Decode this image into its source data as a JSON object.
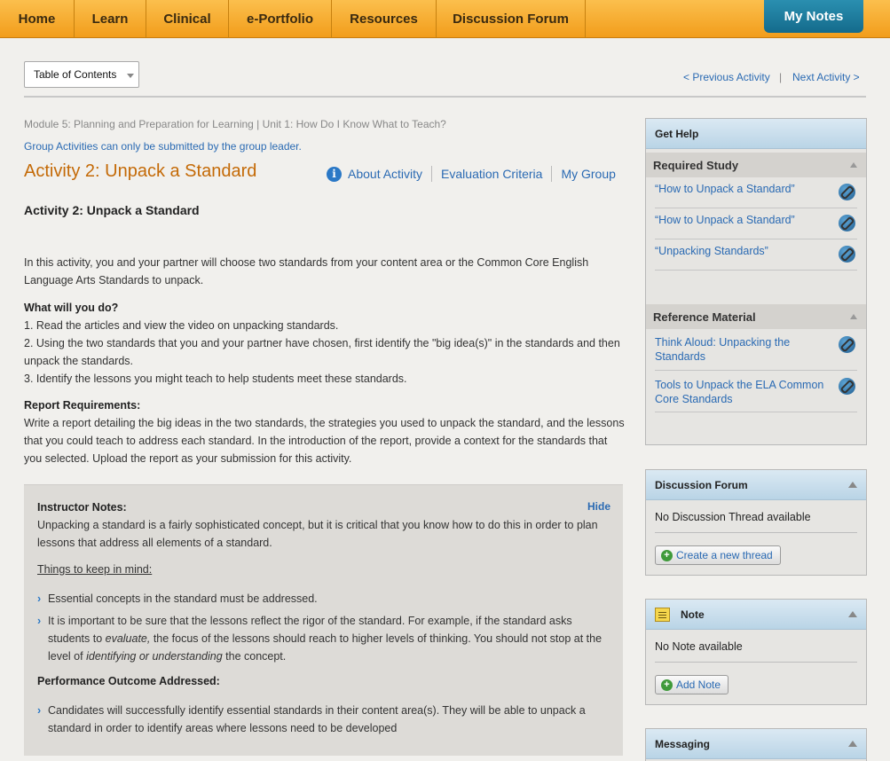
{
  "nav": {
    "items": [
      "Home",
      "Learn",
      "Clinical",
      "e-Portfolio",
      "Resources",
      "Discussion Forum"
    ],
    "my_notes": "My Notes"
  },
  "toolbar": {
    "toc_label": "Table of Contents",
    "previous_activity": "< Previous Activity",
    "separator": "|",
    "next_activity": "Next Activity >"
  },
  "main": {
    "breadcrumb": "Module 5: Planning and Preparation for Learning | Unit 1: How Do I Know What to Teach?",
    "group_note": "Group Activities can only be submitted by the group leader.",
    "title": "Activity 2: Unpack a Standard",
    "links": {
      "about": "About Activity",
      "evaluation": "Evaluation Criteria",
      "group": "My Group"
    },
    "subheading": "Activity 2: Unpack a Standard",
    "intro": "In this activity, you and your partner will choose two standards from your content area or the Common Core English Language Arts Standards to unpack.",
    "what_heading": "What will you do?",
    "steps": [
      "1. Read the articles and view the video on unpacking standards.",
      "2. Using the two standards that you and your partner have chosen, first identify the \"big idea(s)\" in the standards and then unpack the standards.",
      "3. Identify the lessons you might teach to help students meet these standards."
    ],
    "report_heading": "Report Requirements:",
    "report_text": "Write a report detailing the big ideas in the two standards, the strategies you used to unpack the standard, and the lessons that you could teach to address each standard. In the introduction of the report, provide a context for the standards that you selected. Upload the report as your submission for this activity."
  },
  "instructor_notes": {
    "heading": "Instructor Notes:",
    "hide": "Hide",
    "text": "Unpacking a standard is a fairly sophisticated concept, but it is critical that you know how to do this in order to plan lessons that address all elements of a standard.",
    "things_heading": "Things to keep in mind:",
    "bullet1": "Essential concepts in the standard must be addressed.",
    "bullet2_a": "It is important to be sure that the lessons reflect the rigor of the standard. For example, if the standard asks students to ",
    "bullet2_em1": "evaluate,",
    "bullet2_b": " the focus of the lessons should reach to higher levels of thinking. You should not stop at the level of ",
    "bullet2_em2": "identifying or understanding",
    "bullet2_c": " the concept.",
    "performance_heading": "Performance Outcome Addressed:",
    "bullet3": "Candidates will successfully identify essential standards in their content area(s). They will be able to unpack a standard in order to identify areas where lessons need to be developed"
  },
  "sidebar": {
    "get_help": "Get Help",
    "required_study": "Required Study",
    "study_items": [
      "“How to Unpack a Standard”",
      "“How to Unpack a Standard”",
      "“Unpacking Standards”"
    ],
    "reference_material": "Reference Material",
    "reference_items": [
      "Think Aloud: Unpacking the Standards",
      "Tools to Unpack the ELA Common Core Standards"
    ],
    "discussion_forum": "Discussion Forum",
    "no_thread": "No Discussion Thread available",
    "create_thread": "Create a new thread",
    "note": "Note",
    "no_note": "No Note available",
    "add_note": "Add Note",
    "messaging": "Messaging"
  }
}
